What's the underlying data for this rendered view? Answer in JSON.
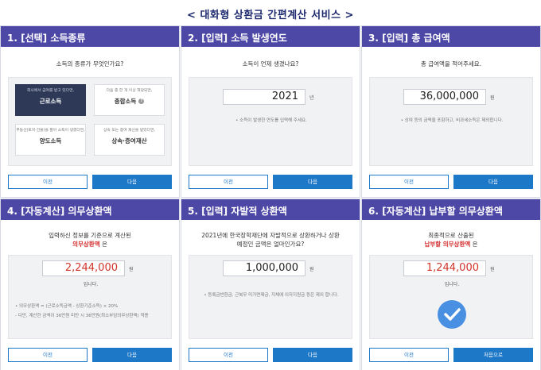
{
  "page_title": "< 대화형 상환금 간편계산 서비스 >",
  "colors": {
    "header": "#4d47a6",
    "primary_button": "#1e78c8",
    "selected_card": "#2d3957",
    "highlight_red": "#d32f2f"
  },
  "panels": {
    "p1": {
      "header": "1. [선택] 소득종류",
      "question": "소득의 종류가 무엇인가요?",
      "cards": [
        {
          "sub": "회사에서 급여를 받고 있다면,",
          "name": "근로소득"
        },
        {
          "sub": "다음 중 한 개 이상 해당되면,",
          "name": "종합소득"
        },
        {
          "sub": "부동산(토지·건물)을 팔아 소득이 생겼다면,",
          "name": "양도소득"
        },
        {
          "sub": "상속 또는 증여 재산을 받았다면,",
          "name": "상속·증여재산"
        }
      ],
      "help_icon": "?",
      "prev": "이전",
      "next": "다음"
    },
    "p2": {
      "header": "2. [입력] 소득 발생연도",
      "question": "소득이 언제 생겼나요?",
      "value": "2021",
      "unit": "년",
      "note": "• 소득이 발생한 연도를 입력해 주세요.",
      "prev": "이전",
      "next": "다음"
    },
    "p3": {
      "header": "3. [입력] 총 급여액",
      "question": "총 급여액을 적어주세요.",
      "value": "36,000,000",
      "unit": "원",
      "note": "• 상여 등의 금액을 포함하고, 비과세소득은 제외합니다.",
      "prev": "이전",
      "next": "다음"
    },
    "p4": {
      "header": "4. [자동계산] 의무상환액",
      "question_line1": "입력하신 정보를 기준으로 계산된",
      "question_red": "의무상환액",
      "question_tail": " 은",
      "value": "2,244,000",
      "unit": "원",
      "after": "입니다.",
      "note1": "• 의무상환액 = (근로소득금액 - 상환기준소득) × 20%",
      "note2": "- 다만, 계산한 금액이 36만원 미만 시 36만원(최소부담의무상환액) 적용",
      "prev": "이전",
      "next": "다음"
    },
    "p5": {
      "header": "5. [입력] 자발적 상환액",
      "question_line1": "2021년에 한국장학재단에 자발적으로 상환하거나 상환",
      "question_line2": "예정인 금액은 얼마인가요?",
      "value": "1,000,000",
      "unit": "원",
      "note": "• 등록금반환금, 근복무 미가면제금, 지체에 이자지원금 등은 제외 합니다.",
      "prev": "이전",
      "next": "다음"
    },
    "p6": {
      "header": "6. [자동계산] 납부할 의무상환액",
      "question_line1": "최종적으로 산출된",
      "question_red": "납부할 의무상환액",
      "question_tail": " 은",
      "value": "1,244,000",
      "unit": "원",
      "after": "입니다.",
      "prev": "이전",
      "next": "처음으로"
    }
  }
}
